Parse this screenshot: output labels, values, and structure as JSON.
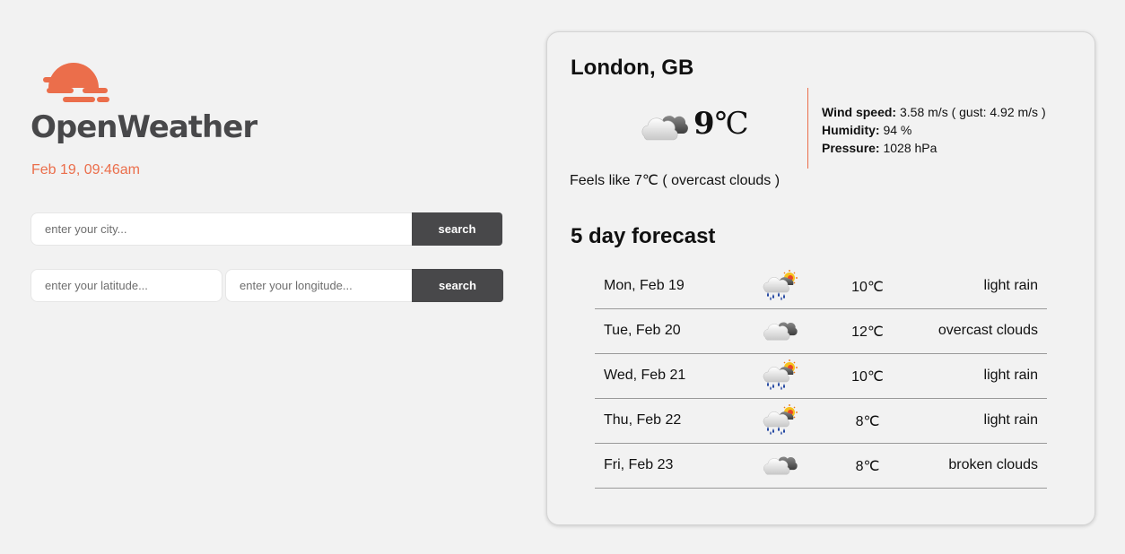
{
  "brand": {
    "name": "OpenWeather",
    "accent_color": "#eb6e4b",
    "text_color": "#48484a"
  },
  "datetime": "Feb 19, 09:46am",
  "city_search": {
    "placeholder": "enter your city...",
    "value": "",
    "button_label": "search"
  },
  "coord_search": {
    "lat_placeholder": "enter your latitude...",
    "lat_value": "",
    "lon_placeholder": "enter your longitude...",
    "lon_value": "",
    "button_label": "search"
  },
  "current": {
    "location": "London, GB",
    "icon": "overcast-clouds-icon",
    "temp": "9",
    "unit": "℃",
    "wind_label": "Wind speed:",
    "wind_value": "3.58 m/s ( gust: 4.92 m/s )",
    "humidity_label": "Humidity:",
    "humidity_value": "94 %",
    "pressure_label": "Pressure:",
    "pressure_value": "1028 hPa",
    "feels_like": "Feels like 7℃ ( overcast clouds )"
  },
  "forecast": {
    "title": "5 day forecast",
    "days": [
      {
        "day": "Mon, Feb 19",
        "icon": "light-rain-icon",
        "temp": "10℃",
        "desc": "light rain"
      },
      {
        "day": "Tue, Feb 20",
        "icon": "overcast-clouds-icon",
        "temp": "12℃",
        "desc": "overcast clouds"
      },
      {
        "day": "Wed, Feb 21",
        "icon": "light-rain-icon",
        "temp": "10℃",
        "desc": "light rain"
      },
      {
        "day": "Thu, Feb 22",
        "icon": "light-rain-icon",
        "temp": "8℃",
        "desc": "light rain"
      },
      {
        "day": "Fri, Feb 23",
        "icon": "broken-clouds-icon",
        "temp": "8℃",
        "desc": "broken clouds"
      }
    ]
  }
}
